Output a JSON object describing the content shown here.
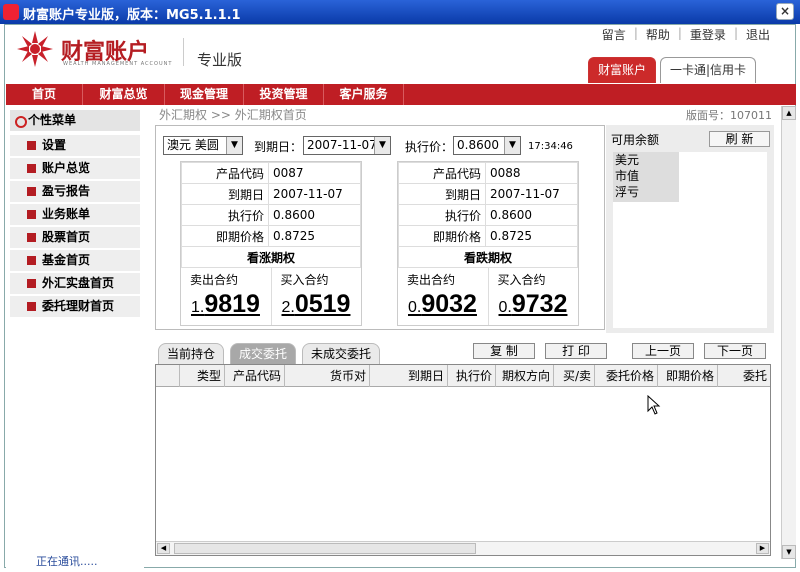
{
  "window": {
    "title": "财富账户专业版，版本：MG5.1.1.1",
    "close": "×"
  },
  "brand": {
    "name": "财富账户",
    "subtitle": "WEALTH MANAGEMENT ACCOUNT",
    "edition": "专业版",
    "brand_color": "#b51d22"
  },
  "toplinks": [
    {
      "label": "留言"
    },
    {
      "label": "帮助"
    },
    {
      "label": "重登录"
    },
    {
      "label": "退出"
    }
  ],
  "maintabs": [
    {
      "label": "财富账户"
    },
    {
      "label": "一卡通|信用卡"
    }
  ],
  "nav": [
    {
      "label": "首页"
    },
    {
      "label": "财富总览"
    },
    {
      "label": "现金管理"
    },
    {
      "label": "投资管理"
    },
    {
      "label": "客户服务"
    }
  ],
  "sidebar": {
    "header": "个性菜单",
    "items": [
      {
        "label": "设置"
      },
      {
        "label": "账户总览"
      },
      {
        "label": "盈亏报告"
      },
      {
        "label": "业务账单"
      },
      {
        "label": "股票首页"
      },
      {
        "label": "基金首页"
      },
      {
        "label": "外汇实盘首页"
      },
      {
        "label": "委托理财首页"
      }
    ]
  },
  "breadcrumb": "外汇期权 >> 外汇期权首页",
  "version": "版面号：107011",
  "controls": {
    "pair": "澳元 美圆",
    "expiry_label": "到期日：",
    "expiry": "2007-11-07",
    "strike_label": "执行价：",
    "strike": "0.8600",
    "time": "17:34:46"
  },
  "call_card": {
    "rows": [
      {
        "k": "产品代码",
        "v": "0087"
      },
      {
        "k": "到期日",
        "v": "2007-11-07"
      },
      {
        "k": "执行价",
        "v": "0.8600"
      },
      {
        "k": "即期价格",
        "v": "0.8725"
      }
    ],
    "type": "看涨期权",
    "sell_label": "卖出合约",
    "sell_prefix": "1.",
    "sell_value": "9819",
    "buy_label": "买入合约",
    "buy_prefix": "2.",
    "buy_value": "0519"
  },
  "put_card": {
    "rows": [
      {
        "k": "产品代码",
        "v": "0088"
      },
      {
        "k": "到期日",
        "v": "2007-11-07"
      },
      {
        "k": "执行价",
        "v": "0.8600"
      },
      {
        "k": "即期价格",
        "v": "0.8725"
      }
    ],
    "type": "看跌期权",
    "sell_label": "卖出合约",
    "sell_prefix": "0.",
    "sell_value": "9032",
    "buy_label": "买入合约",
    "buy_prefix": "0.",
    "buy_value": "9732"
  },
  "balance": {
    "title": "可用余额",
    "refresh": "刷  新",
    "items": [
      "美元",
      "市值",
      "浮亏"
    ]
  },
  "order_tabs": [
    {
      "label": "当前持仓"
    },
    {
      "label": "成交委托"
    },
    {
      "label": "未成交委托"
    }
  ],
  "buttons": {
    "copy": "复  制",
    "print": "打  印",
    "prev": "上一页",
    "next": "下一页"
  },
  "columns": [
    "类型",
    "产品代码",
    "货币对",
    "到期日",
    "执行价",
    "期权方向",
    "买/卖",
    "委托价格",
    "即期价格",
    "委托"
  ],
  "status": "正在通讯....."
}
